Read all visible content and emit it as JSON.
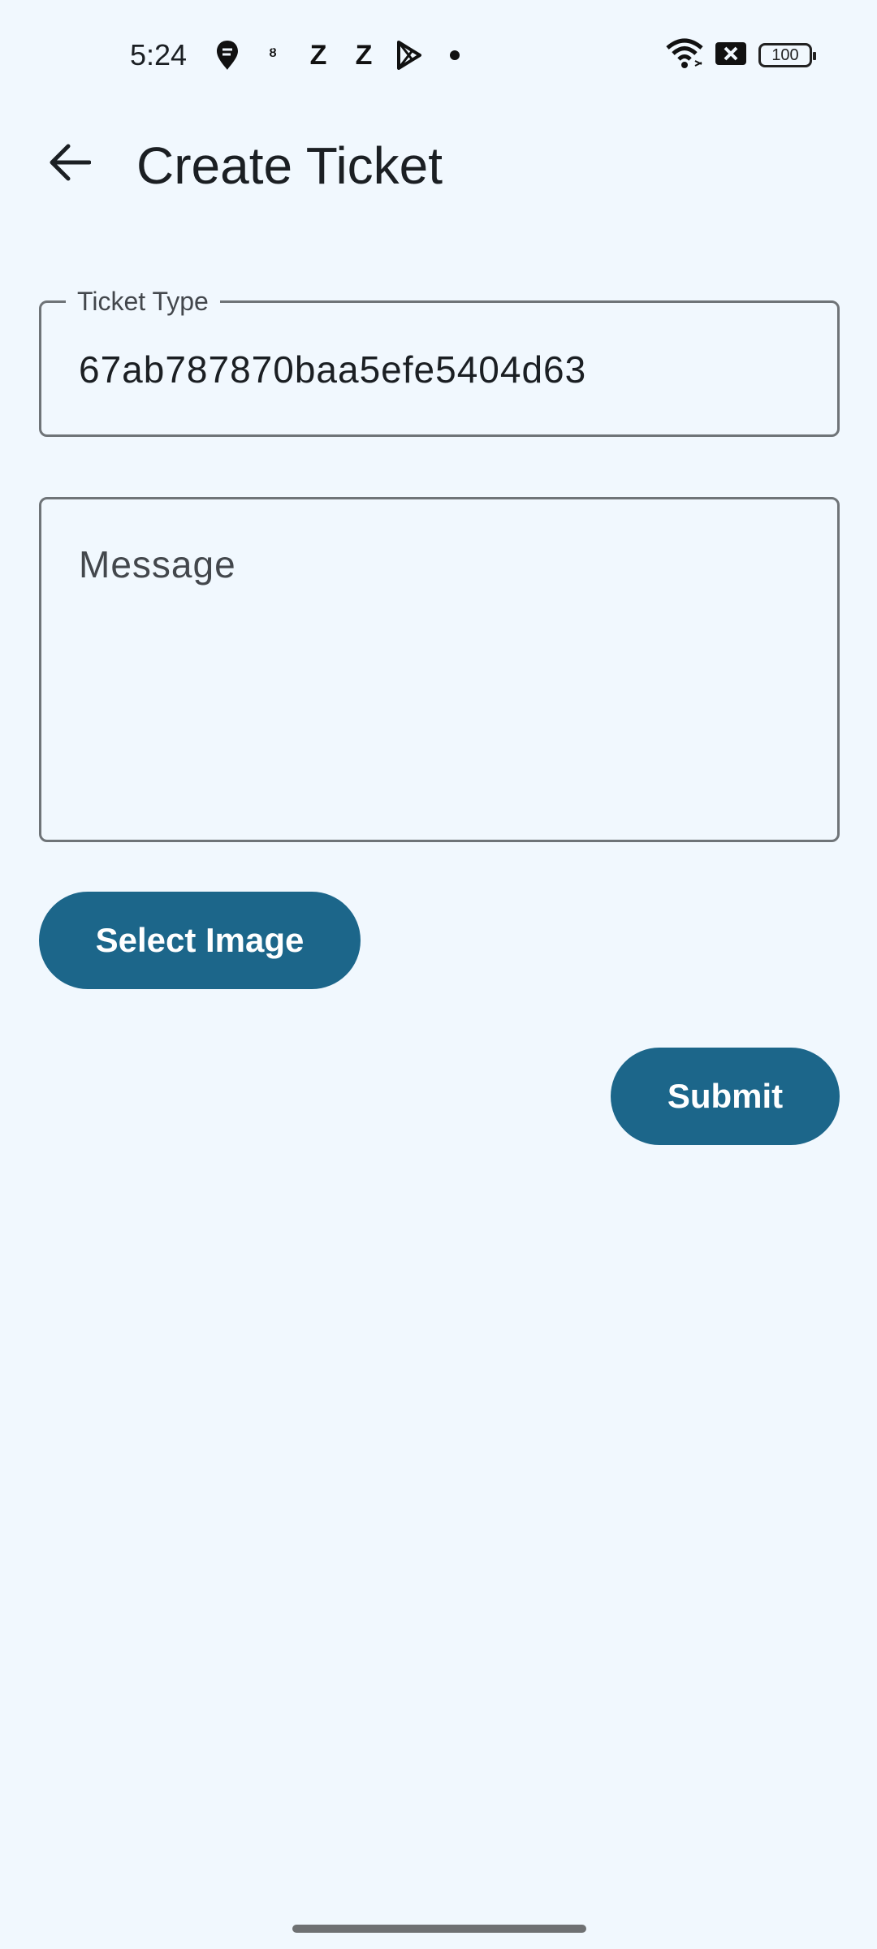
{
  "status_bar": {
    "time": "5:24",
    "notification_icons": [
      "swiggy-icon",
      "bug-icon",
      "zepto-icon",
      "zepto-icon",
      "play-store-icon",
      "dot-icon"
    ],
    "wifi": "wifi-icon",
    "data_blocked": "no-data-icon",
    "battery": "100"
  },
  "app_bar": {
    "back_icon": "arrow-back-icon",
    "title": "Create Ticket"
  },
  "form": {
    "ticket_type": {
      "label": "Ticket Type",
      "value": "67ab787870baa5efe5404d63"
    },
    "message": {
      "placeholder": "Message",
      "value": ""
    },
    "select_image_label": "Select Image",
    "submit_label": "Submit"
  },
  "colors": {
    "background": "#f1f8fe",
    "primary": "#1c668a",
    "outline": "#6f7478"
  }
}
